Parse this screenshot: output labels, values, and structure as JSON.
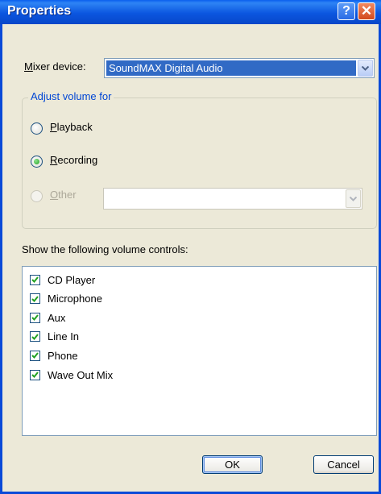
{
  "window": {
    "title": "Properties",
    "help_glyph": "?",
    "close_glyph": "✕"
  },
  "mixer": {
    "label": "Mixer device:",
    "value": "SoundMAX Digital Audio"
  },
  "adjust_group": {
    "legend": "Adjust volume for",
    "options": [
      {
        "label": "Playback",
        "checked": false,
        "enabled": true
      },
      {
        "label": "Recording",
        "checked": true,
        "enabled": true
      },
      {
        "label": "Other",
        "checked": false,
        "enabled": false
      }
    ],
    "other_combo_value": ""
  },
  "controls": {
    "label": "Show the following volume controls:",
    "items": [
      {
        "label": "CD Player",
        "checked": true
      },
      {
        "label": "Microphone",
        "checked": true
      },
      {
        "label": "Aux",
        "checked": true
      },
      {
        "label": "Line In",
        "checked": true
      },
      {
        "label": "Phone",
        "checked": true
      },
      {
        "label": "Wave Out Mix",
        "checked": true
      }
    ]
  },
  "buttons": {
    "ok": "OK",
    "cancel": "Cancel"
  },
  "colors": {
    "title_blue": "#0A4AD8",
    "dialog_bg": "#ECE9D8",
    "selection": "#316AC5",
    "check_green": "#21A121"
  }
}
